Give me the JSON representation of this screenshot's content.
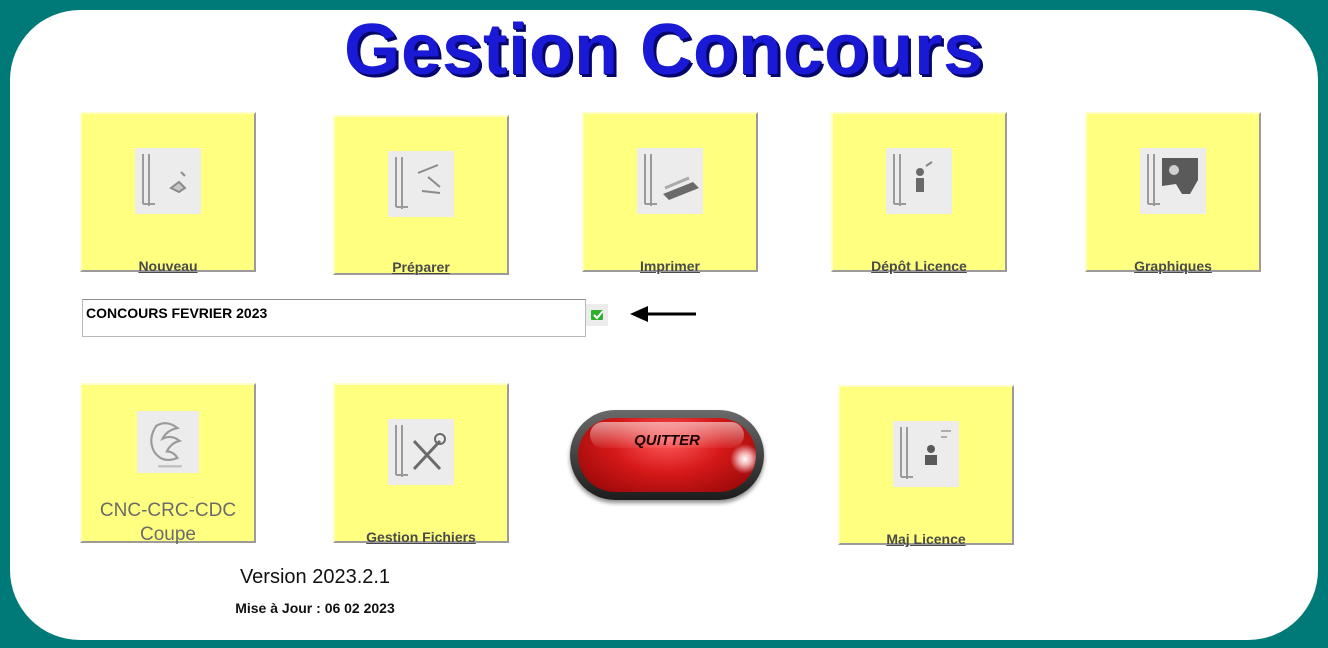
{
  "app": {
    "title": "Gestion Concours",
    "version": "Version 2023.2.1",
    "update": "Mise à Jour : 06 02 2023"
  },
  "tiles_top": [
    {
      "label": "Nouveau",
      "icon": "new-contest-icon"
    },
    {
      "label": "Préparer",
      "icon": "prepare-icon"
    },
    {
      "label": "Imprimer",
      "icon": "printer-icon"
    },
    {
      "label": "Dépôt Licence",
      "icon": "license-deposit-icon"
    },
    {
      "label": "Graphiques",
      "icon": "graphics-icon"
    }
  ],
  "tiles_bottom": [
    {
      "label_line1": "CNC-CRC-CDC",
      "label_line2": "Coupe",
      "icon": "rooster-icon"
    },
    {
      "label": "Gestion Fichiers",
      "icon": "tools-icon"
    },
    {
      "label": "Maj Licence",
      "icon": "license-update-icon"
    }
  ],
  "contest": {
    "value": "CONCOURS FEVRIER 2023"
  },
  "quit": {
    "label": "QUITTER"
  },
  "colors": {
    "background": "#007a78",
    "tile": "#ffff80",
    "title": "#1a1ad6",
    "quit": "#d61818"
  }
}
